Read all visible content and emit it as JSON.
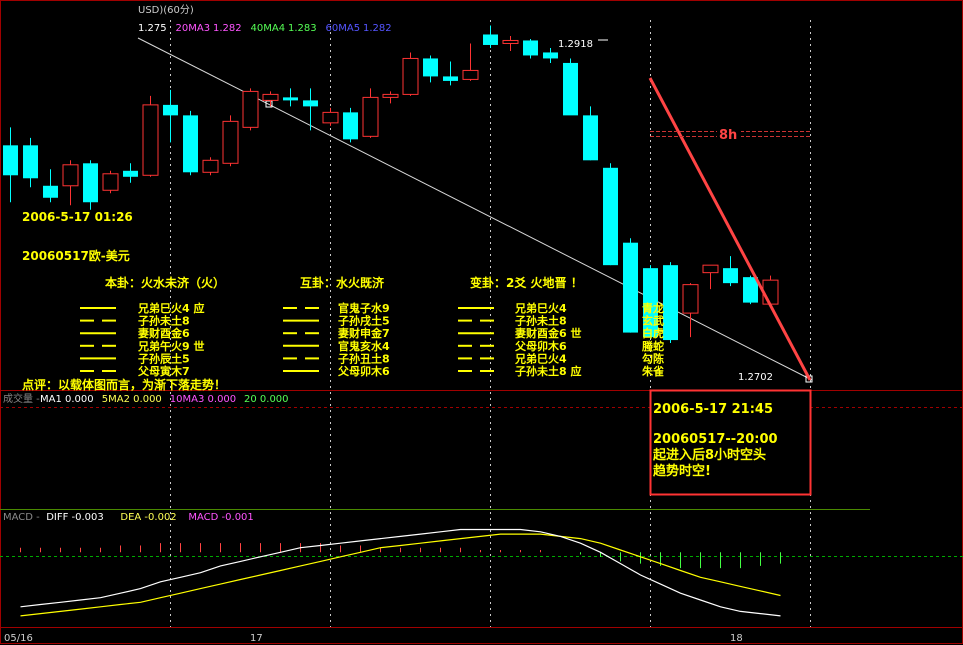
{
  "header": {
    "symbol": "USD)(60分)",
    "ma_items": [
      {
        "label": "1.275",
        "color": "#ffffff"
      },
      {
        "label": "20MA3",
        "color": "#ff55ff"
      },
      {
        "label": "1.282",
        "color": "#ff55ff"
      },
      {
        "label": "40MA4",
        "color": "#55ff55"
      },
      {
        "label": "1.283",
        "color": "#55ff55"
      },
      {
        "label": "60MA5",
        "color": "#5555ff"
      },
      {
        "label": "1.282",
        "color": "#5555ff"
      }
    ]
  },
  "annotations": {
    "timestamp": "2006-5-17 01:26",
    "pair": "20060517欧-美元",
    "high_label": "1.2918",
    "low_label": "1.2702",
    "interval_label": "8h",
    "comment": "点评：以载体图而言，为渐下落走势！"
  },
  "hexagram": {
    "headers": [
      "本卦：火水未济（火）",
      "互卦：水火既济",
      "变卦：2爻 火地晋 ！"
    ],
    "lines": [
      {
        "line": "yang",
        "text1": "兄弟巳火4  应",
        "line2": "yin",
        "text2": "官鬼子水9",
        "line3": "yang",
        "text3": "兄弟巳火4",
        "animal": "青龙"
      },
      {
        "line": "yin",
        "text1": "子孙未土8",
        "line2": "yang",
        "text2": "子孙戌土5",
        "line3": "yin",
        "text3": "子孙未土8",
        "animal": "玄武"
      },
      {
        "line": "yang",
        "text1": "妻财酉金6",
        "line2": "yin",
        "text2": "妻财申金7",
        "line3": "yang",
        "text3": "妻财酉金6  世",
        "animal": "白虎"
      },
      {
        "line": "yin",
        "text1": "兄弟午火9  世",
        "line2": "yang",
        "text2": "官鬼亥水4",
        "line3": "yin",
        "text3": "父母卯木6",
        "animal": "螣蛇"
      },
      {
        "line": "yang",
        "text1": "子孙辰土5",
        "line2": "yin",
        "text2": "子孙丑土8",
        "line3": "yin",
        "text3": "兄弟巳火4",
        "animal": "勾陈"
      },
      {
        "line": "yin",
        "text1": "父母寅木7",
        "line2": "yang",
        "text2": "父母卯木6",
        "line3": "yin",
        "text3": "子孙未土8  应",
        "animal": "朱雀"
      }
    ]
  },
  "volume_header": {
    "items": [
      {
        "label": "成交量 -",
        "color": "#888888"
      },
      {
        "label": "MA1 0.000",
        "color": "#ffffff"
      },
      {
        "label": "5MA2 0.000",
        "color": "#ffff55"
      },
      {
        "label": "10MA3 0.000",
        "color": "#ff55ff"
      },
      {
        "label": "20 0.000",
        "color": "#55ff55"
      }
    ]
  },
  "info_box": {
    "line1": "2006-5-17 21:45",
    "line2": "20060517--20:00",
    "line3": "起进入后8小时空头",
    "line4": "趋势时空!"
  },
  "macd_header": {
    "items": [
      {
        "label": "MACD -",
        "color": "#888888"
      },
      {
        "label": "DIFF -0.003",
        "color": "#ffffff"
      },
      {
        "label": "DEA -0.002",
        "color": "#ffff55"
      },
      {
        "label": "MACD -0.001",
        "color": "#ff55ff"
      }
    ]
  },
  "x_axis": {
    "labels": [
      "05/16",
      "17",
      "18"
    ]
  },
  "colors": {
    "up": "#ff3333",
    "down": "#00ffff",
    "grid": "#a00000",
    "annotation": "#ffff00",
    "hexagram_text": "#ffff00",
    "box_border": "#ff3333",
    "trend_line": "#ff4444",
    "diff_line": "#ffffff",
    "dea_line": "#ffff00"
  },
  "chart_data": {
    "type": "candlestick",
    "price_ylim": [
      1.269,
      1.2935
    ],
    "high_marker": 1.2918,
    "low_marker": 1.2702,
    "candles": [
      {
        "o": 1.285,
        "h": 1.2862,
        "l": 1.2812,
        "c": 1.283
      },
      {
        "o": 1.285,
        "h": 1.2855,
        "l": 1.2822,
        "c": 1.2828
      },
      {
        "o": 1.2823,
        "h": 1.2834,
        "l": 1.2812,
        "c": 1.2815
      },
      {
        "o": 1.2823,
        "h": 1.284,
        "l": 1.281,
        "c": 1.2837
      },
      {
        "o": 1.2838,
        "h": 1.284,
        "l": 1.2807,
        "c": 1.2812
      },
      {
        "o": 1.282,
        "h": 1.2833,
        "l": 1.2818,
        "c": 1.2831
      },
      {
        "o": 1.2833,
        "h": 1.2838,
        "l": 1.2825,
        "c": 1.2829
      },
      {
        "o": 1.283,
        "h": 1.2883,
        "l": 1.2829,
        "c": 1.2877
      },
      {
        "o": 1.2877,
        "h": 1.2887,
        "l": 1.2852,
        "c": 1.287
      },
      {
        "o": 1.287,
        "h": 1.2873,
        "l": 1.283,
        "c": 1.2832
      },
      {
        "o": 1.2832,
        "h": 1.2842,
        "l": 1.283,
        "c": 1.284
      },
      {
        "o": 1.2838,
        "h": 1.287,
        "l": 1.2836,
        "c": 1.2866
      },
      {
        "o": 1.2862,
        "h": 1.2888,
        "l": 1.286,
        "c": 1.2886
      },
      {
        "o": 1.288,
        "h": 1.2886,
        "l": 1.2876,
        "c": 1.2884
      },
      {
        "o": 1.2882,
        "h": 1.2888,
        "l": 1.2876,
        "c": 1.288
      },
      {
        "o": 1.288,
        "h": 1.2888,
        "l": 1.286,
        "c": 1.2876
      },
      {
        "o": 1.2865,
        "h": 1.2875,
        "l": 1.2863,
        "c": 1.2872
      },
      {
        "o": 1.2872,
        "h": 1.2875,
        "l": 1.2852,
        "c": 1.2854
      },
      {
        "o": 1.2856,
        "h": 1.2888,
        "l": 1.2855,
        "c": 1.2882
      },
      {
        "o": 1.2882,
        "h": 1.2886,
        "l": 1.2878,
        "c": 1.2884
      },
      {
        "o": 1.2884,
        "h": 1.2912,
        "l": 1.2883,
        "c": 1.2908
      },
      {
        "o": 1.2908,
        "h": 1.291,
        "l": 1.2892,
        "c": 1.2896
      },
      {
        "o": 1.2896,
        "h": 1.2906,
        "l": 1.289,
        "c": 1.2893
      },
      {
        "o": 1.2894,
        "h": 1.2918,
        "l": 1.2893,
        "c": 1.29
      },
      {
        "o": 1.2924,
        "h": 1.293,
        "l": 1.2915,
        "c": 1.2917
      },
      {
        "o": 1.2918,
        "h": 1.2923,
        "l": 1.2913,
        "c": 1.292
      },
      {
        "o": 1.292,
        "h": 1.2921,
        "l": 1.2908,
        "c": 1.291
      },
      {
        "o": 1.2912,
        "h": 1.2915,
        "l": 1.2905,
        "c": 1.2908
      },
      {
        "o": 1.2905,
        "h": 1.2908,
        "l": 1.2875,
        "c": 1.287
      },
      {
        "o": 1.287,
        "h": 1.2876,
        "l": 1.284,
        "c": 1.284
      },
      {
        "o": 1.2835,
        "h": 1.2838,
        "l": 1.277,
        "c": 1.277
      },
      {
        "o": 1.2785,
        "h": 1.2788,
        "l": 1.2725,
        "c": 1.2725
      },
      {
        "o": 1.2768,
        "h": 1.277,
        "l": 1.2722,
        "c": 1.2722
      },
      {
        "o": 1.277,
        "h": 1.2772,
        "l": 1.2718,
        "c": 1.272
      },
      {
        "o": 1.2738,
        "h": 1.2758,
        "l": 1.2722,
        "c": 1.2757
      },
      {
        "o": 1.2765,
        "h": 1.277,
        "l": 1.2754,
        "c": 1.277
      },
      {
        "o": 1.2768,
        "h": 1.2776,
        "l": 1.2756,
        "c": 1.2758
      },
      {
        "o": 1.2762,
        "h": 1.2763,
        "l": 1.2744,
        "c": 1.2745
      },
      {
        "o": 1.2744,
        "h": 1.2763,
        "l": 1.2742,
        "c": 1.276
      }
    ],
    "macd": {
      "ylim": [
        -0.0032,
        0.0012
      ],
      "diff": [
        -0.0024,
        -0.0023,
        -0.0022,
        -0.0021,
        -0.002,
        -0.0018,
        -0.0016,
        -0.0013,
        -0.0011,
        -0.0009,
        -0.0006,
        -0.0004,
        -0.0002,
        0.0,
        0.0002,
        0.0003,
        0.0004,
        0.0005,
        0.0006,
        0.0007,
        0.0008,
        0.0009,
        0.001,
        0.001,
        0.001,
        0.001,
        0.0009,
        0.0007,
        0.0004,
        0.0,
        -0.0005,
        -0.001,
        -0.0014,
        -0.0018,
        -0.0021,
        -0.0024,
        -0.0026,
        -0.0027,
        -0.0028
      ],
      "dea": [
        -0.0028,
        -0.0027,
        -0.0026,
        -0.0025,
        -0.0024,
        -0.0023,
        -0.0022,
        -0.002,
        -0.0018,
        -0.0016,
        -0.0014,
        -0.0012,
        -0.001,
        -0.0008,
        -0.0006,
        -0.0004,
        -0.0002,
        0.0,
        0.0002,
        0.0003,
        0.0004,
        0.0005,
        0.0006,
        0.0007,
        0.0008,
        0.0008,
        0.0008,
        0.0007,
        0.0006,
        0.0004,
        0.0001,
        -0.0002,
        -0.0005,
        -0.0008,
        -0.0011,
        -0.0013,
        -0.0015,
        -0.0017,
        -0.0019
      ],
      "hist": [
        0.0002,
        0.0002,
        0.0002,
        0.0002,
        0.0002,
        0.0003,
        0.0003,
        0.0004,
        0.0004,
        0.0004,
        0.0004,
        0.0004,
        0.0004,
        0.0004,
        0.0004,
        0.0004,
        0.0003,
        0.0003,
        0.0002,
        0.0002,
        0.0002,
        0.0002,
        0.0002,
        0.0001,
        0.0001,
        0.0001,
        0.0001,
        0.0,
        -0.0001,
        -0.0002,
        -0.0004,
        -0.0005,
        -0.0006,
        -0.0007,
        -0.0007,
        -0.0007,
        -0.0007,
        -0.0006,
        -0.0005
      ]
    }
  }
}
